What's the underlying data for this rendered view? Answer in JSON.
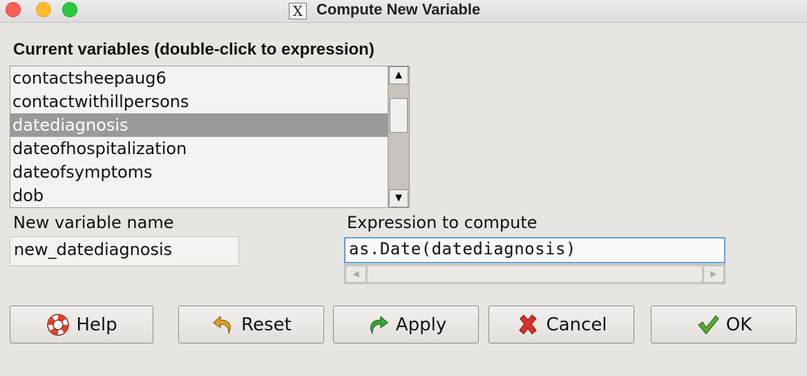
{
  "window": {
    "title": "Compute New Variable",
    "app_icon": "x11-icon",
    "app_icon_glyph": "X"
  },
  "variables": {
    "label": "Current variables (double-click to expression)",
    "items": [
      {
        "label": "contactsheepaug6",
        "selected": false
      },
      {
        "label": "contactwithillpersons",
        "selected": false
      },
      {
        "label": "datediagnosis",
        "selected": true
      },
      {
        "label": "dateofhospitalization",
        "selected": false
      },
      {
        "label": "dateofsymptoms",
        "selected": false
      },
      {
        "label": "dob",
        "selected": false
      }
    ],
    "scroll_up_glyph": "▲",
    "scroll_down_glyph": "▼"
  },
  "new_variable": {
    "label": "New variable name",
    "value": "new_datediagnosis"
  },
  "expression": {
    "label": "Expression to compute",
    "value": "as.Date(datediagnosis)",
    "scroll_left_glyph": "◀",
    "scroll_right_glyph": "▶"
  },
  "buttons": {
    "help": {
      "label": "Help",
      "icon": "lifebuoy-icon"
    },
    "reset": {
      "label": "Reset",
      "icon": "undo-arrow-icon"
    },
    "apply": {
      "label": "Apply",
      "icon": "redo-arrow-icon"
    },
    "cancel": {
      "label": "Cancel",
      "icon": "red-x-icon"
    },
    "ok": {
      "label": "OK",
      "icon": "checkmark-icon"
    }
  },
  "colors": {
    "selection": "#9c999d",
    "focus_border": "#5f9fd6",
    "apply_green": "#3aa33a",
    "cancel_red": "#d9322b",
    "ok_green": "#5ea832",
    "reset_yellow": "#d9a528",
    "help_red": "#e0442a"
  }
}
